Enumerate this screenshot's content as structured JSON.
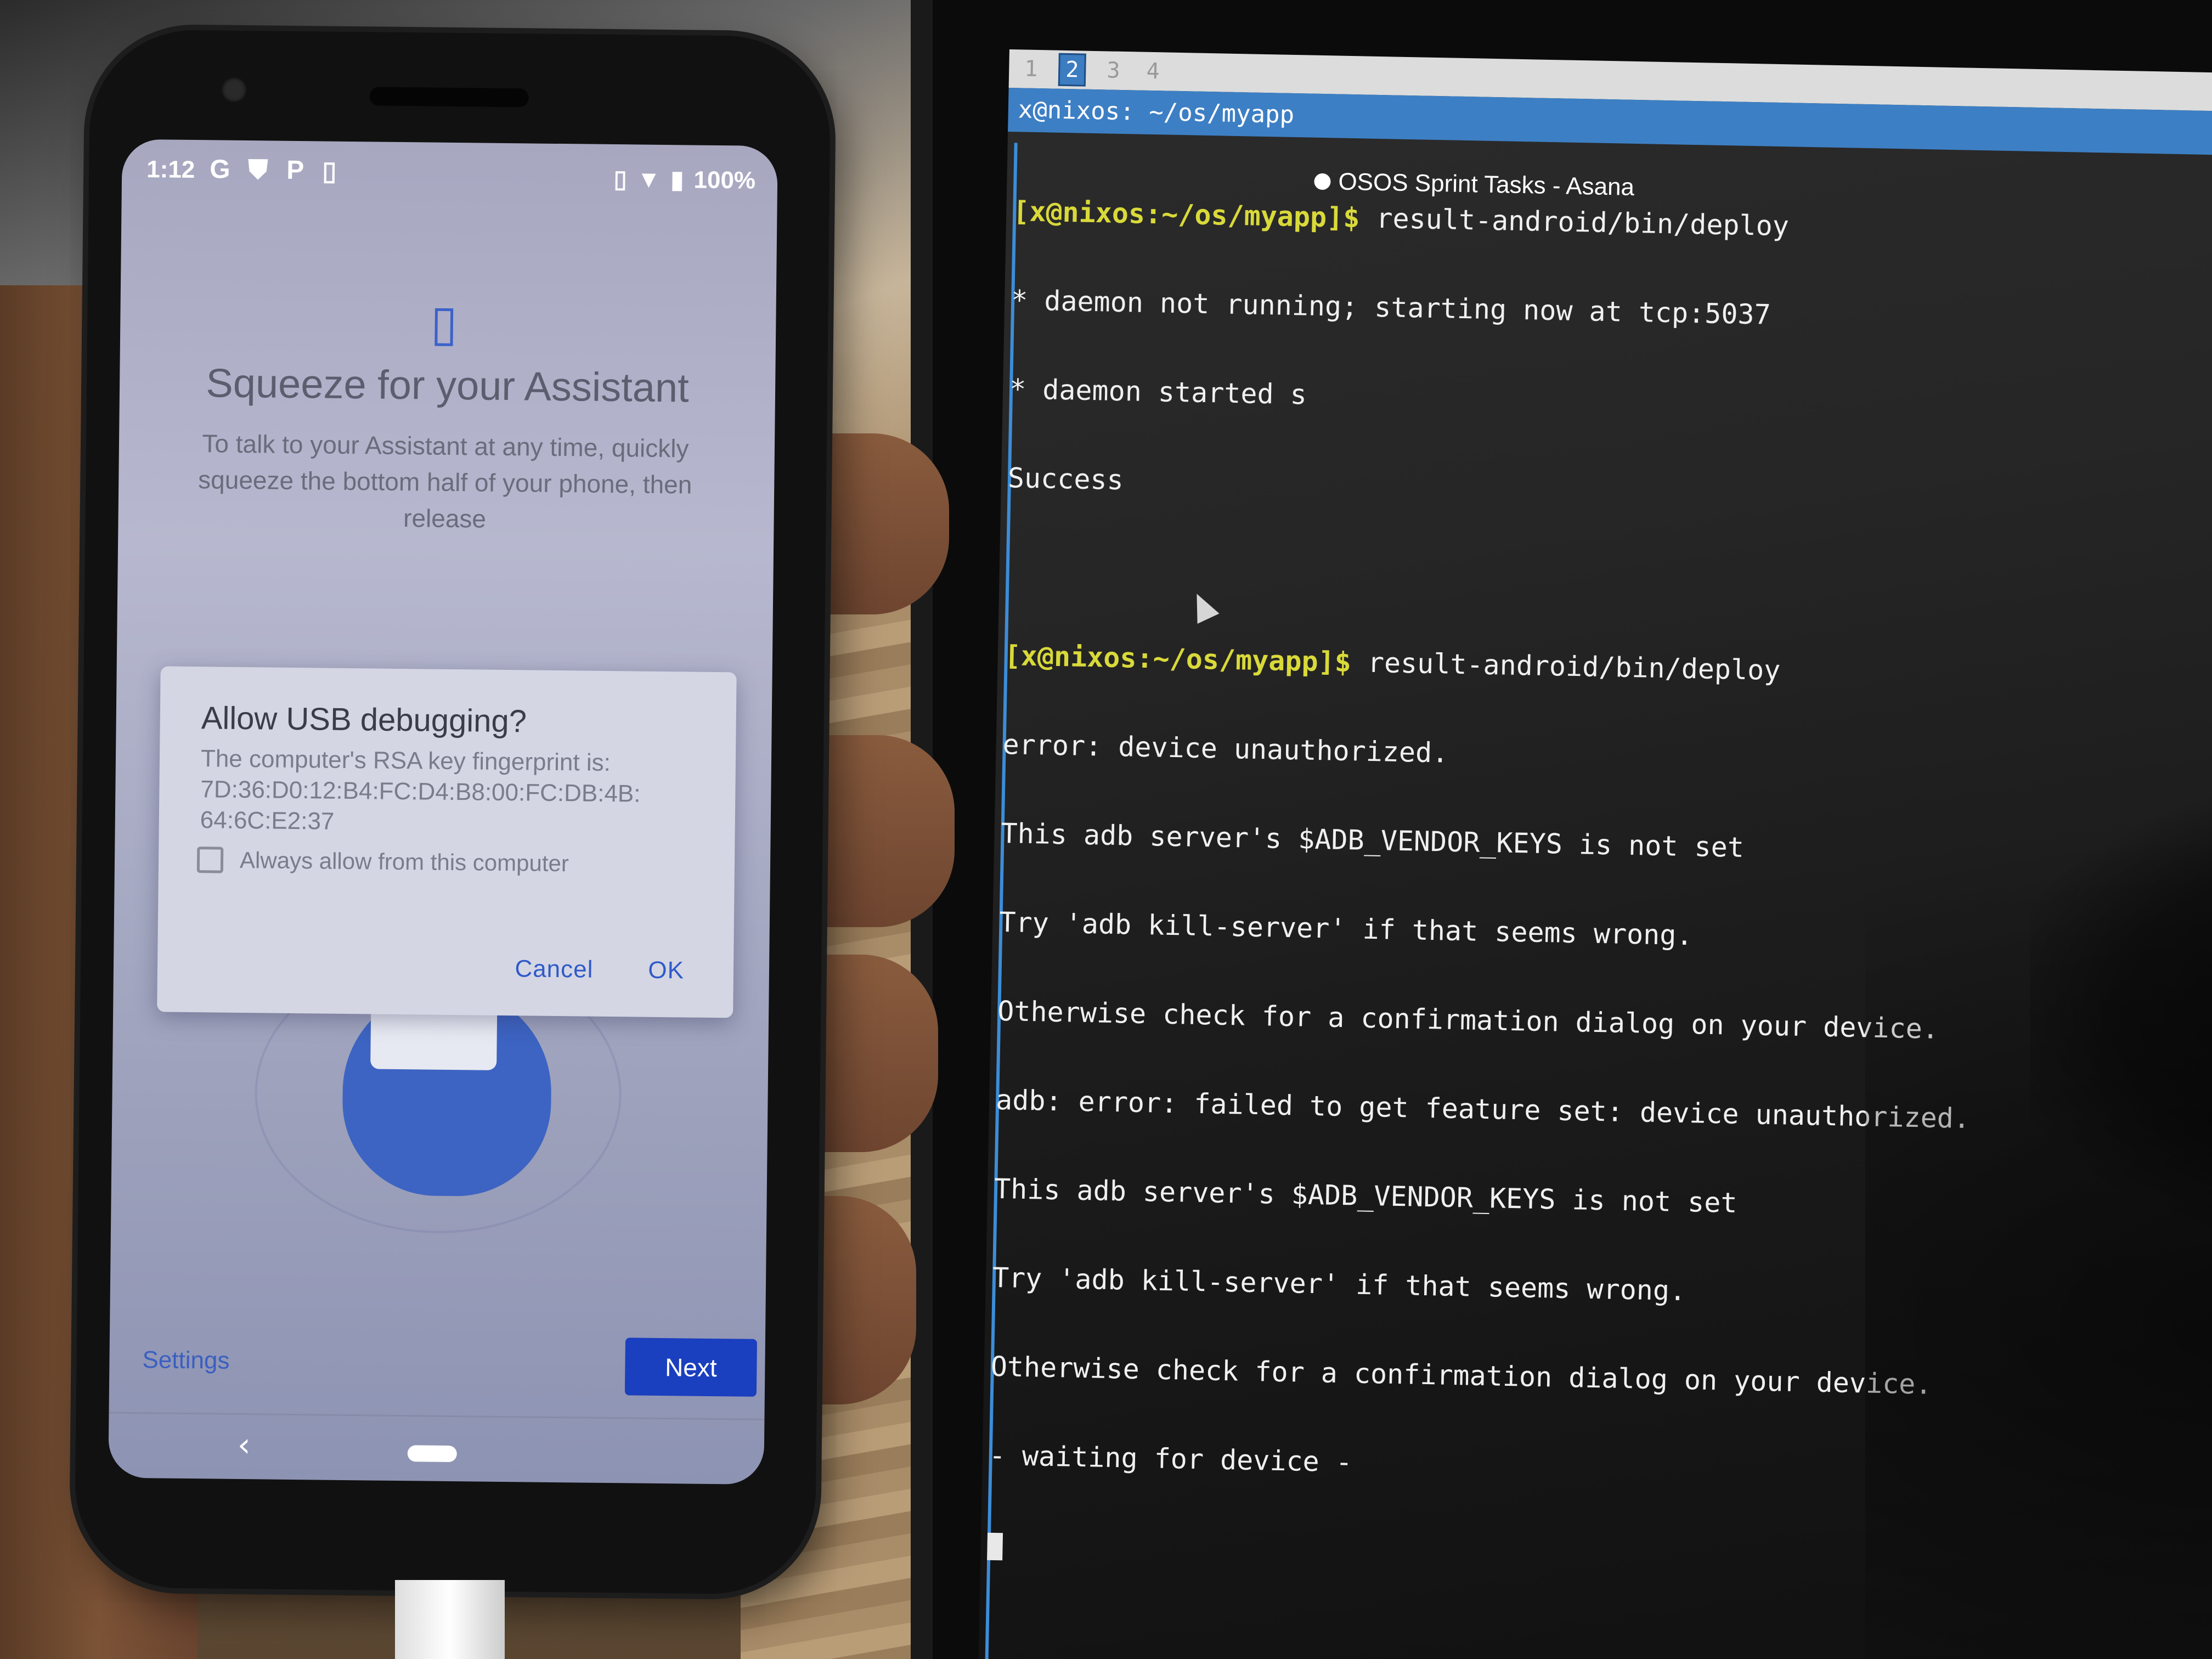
{
  "phone": {
    "status_time": "1:12",
    "status_icons": [
      "google-g-icon",
      "shield-icon",
      "parking-icon",
      "battery-saver-icon"
    ],
    "battery": "100%",
    "assistant": {
      "icon": "squeeze-phone-icon",
      "title": "Squeeze for your Assistant",
      "body": "To talk to your Assistant at any time, quickly squeeze the bottom half of your phone, then release"
    },
    "dialog": {
      "title": "Allow USB debugging?",
      "body": "The computer's RSA key fingerprint is: 7D:36:D0:12:B4:FC:D4:B8:00:FC:DB:4B: 64:6C:E2:37",
      "checkbox_label": "Always allow from this computer",
      "checkbox_checked": false,
      "cancel_label": "Cancel",
      "ok_label": "OK"
    },
    "settings_label": "Settings",
    "next_label": "Next",
    "colors": {
      "accent": "#1a3fbf",
      "dialog_bg": "#d4d6e4"
    }
  },
  "terminal": {
    "tabs": [
      "1",
      "2",
      "3",
      "4"
    ],
    "active_tab": "2",
    "title": "x@nixos: ~/os/myapp",
    "notification": "OSOS Sprint Tasks - Asana",
    "lines": [
      {
        "prompt": "[x@nixos:~/os/myapp]$",
        "text": " result-android/bin/deploy"
      },
      {
        "prompt": "",
        "text": "* daemon not running; starting now at tcp:5037"
      },
      {
        "prompt": "",
        "text": "* daemon started s"
      },
      {
        "prompt": "",
        "text": "Success"
      },
      {
        "prompt": "",
        "text": ""
      },
      {
        "prompt": "[x@nixos:~/os/myapp]$",
        "text": " result-android/bin/deploy"
      },
      {
        "prompt": "",
        "text": "error: device unauthorized."
      },
      {
        "prompt": "",
        "text": "This adb server's $ADB_VENDOR_KEYS is not set"
      },
      {
        "prompt": "",
        "text": "Try 'adb kill-server' if that seems wrong."
      },
      {
        "prompt": "",
        "text": "Otherwise check for a confirmation dialog on your device."
      },
      {
        "prompt": "",
        "text": "adb: error: failed to get feature set: device unauthorized."
      },
      {
        "prompt": "",
        "text": "This adb server's $ADB_VENDOR_KEYS is not set"
      },
      {
        "prompt": "",
        "text": "Try 'adb kill-server' if that seems wrong."
      },
      {
        "prompt": "",
        "text": "Otherwise check for a confirmation dialog on your device."
      },
      {
        "prompt": "",
        "text": "- waiting for device -"
      }
    ],
    "colors": {
      "prompt": "#d9d93a",
      "titlebar": "#3d7fc4"
    }
  }
}
